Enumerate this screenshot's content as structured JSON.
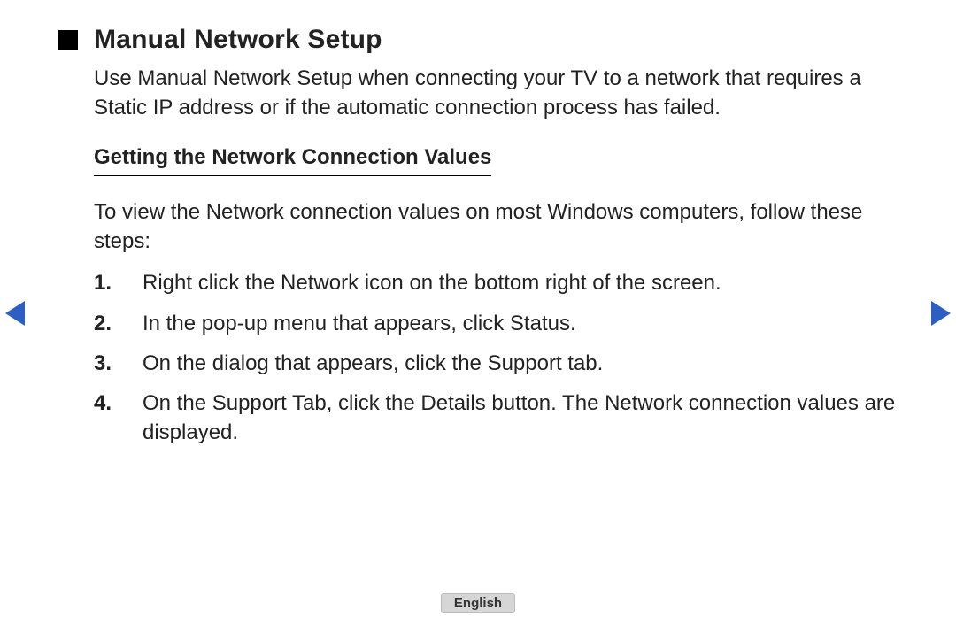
{
  "title": "Manual Network Setup",
  "intro": "Use Manual Network Setup when connecting your TV to a network that requires a Static IP address or if the automatic connection process has failed.",
  "subheading": "Getting the Network Connection Values",
  "lead": "To view the Network connection values on most Windows computers, follow these steps:",
  "steps": [
    {
      "num": "1",
      "text": "Right click the Network icon on the bottom right of the screen."
    },
    {
      "num": "2",
      "text": "In the pop-up menu that appears, click Status."
    },
    {
      "num": "3",
      "text": "On the dialog that appears, click the Support tab."
    },
    {
      "num": "4",
      "text": "On the Support Tab, click the Details button. The Network connection values are displayed."
    }
  ],
  "language_label": "English"
}
